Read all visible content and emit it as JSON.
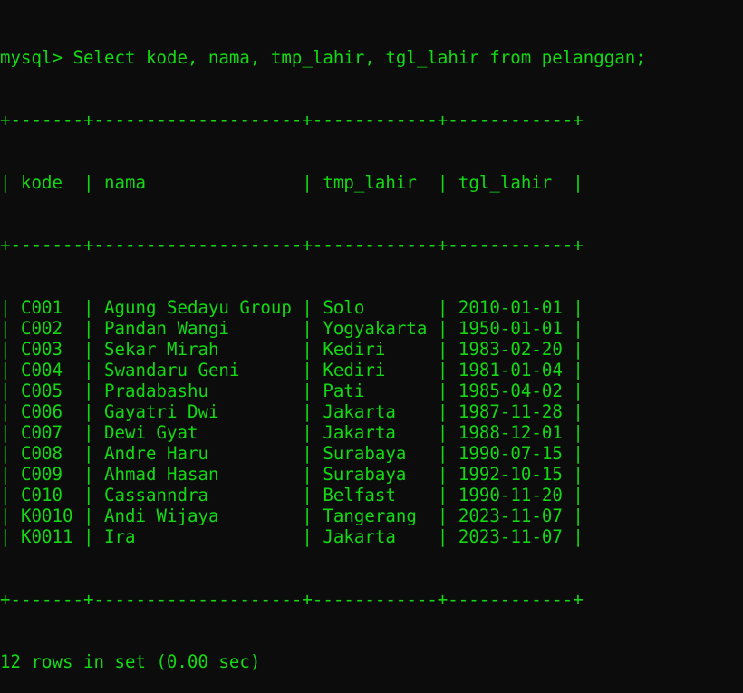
{
  "terminal": {
    "prompt": "mysql>",
    "command": "Select kode, nama, tmp_lahir, tgl_lahir from pelanggan;",
    "border": "+-------+--------------------+------------+------------+",
    "columns": [
      "kode",
      "nama",
      "tmp_lahir",
      "tgl_lahir"
    ],
    "rows": [
      [
        "C001",
        "Agung Sedayu Group",
        "Solo",
        "2010-01-01"
      ],
      [
        "C002",
        "Pandan Wangi",
        "Yogyakarta",
        "1950-01-01"
      ],
      [
        "C003",
        "Sekar Mirah",
        "Kediri",
        "1983-02-20"
      ],
      [
        "C004",
        "Swandaru Geni",
        "Kediri",
        "1981-01-04"
      ],
      [
        "C005",
        "Pradabashu",
        "Pati",
        "1985-04-02"
      ],
      [
        "C006",
        "Gayatri Dwi",
        "Jakarta",
        "1987-11-28"
      ],
      [
        "C007",
        "Dewi Gyat",
        "Jakarta",
        "1988-12-01"
      ],
      [
        "C008",
        "Andre Haru",
        "Surabaya",
        "1990-07-15"
      ],
      [
        "C009",
        "Ahmad Hasan",
        "Surabaya",
        "1992-10-15"
      ],
      [
        "C010",
        "Cassanndra",
        "Belfast",
        "1990-11-20"
      ],
      [
        "K0010",
        "Andi Wijaya",
        "Tangerang",
        "2023-11-07"
      ],
      [
        "K0011",
        "Ira",
        "Jakarta",
        "2023-11-07"
      ]
    ],
    "footer": "12 rows in set (0.00 sec)",
    "colors": {
      "background": "#0c0c0c",
      "text": "#13d813"
    }
  }
}
